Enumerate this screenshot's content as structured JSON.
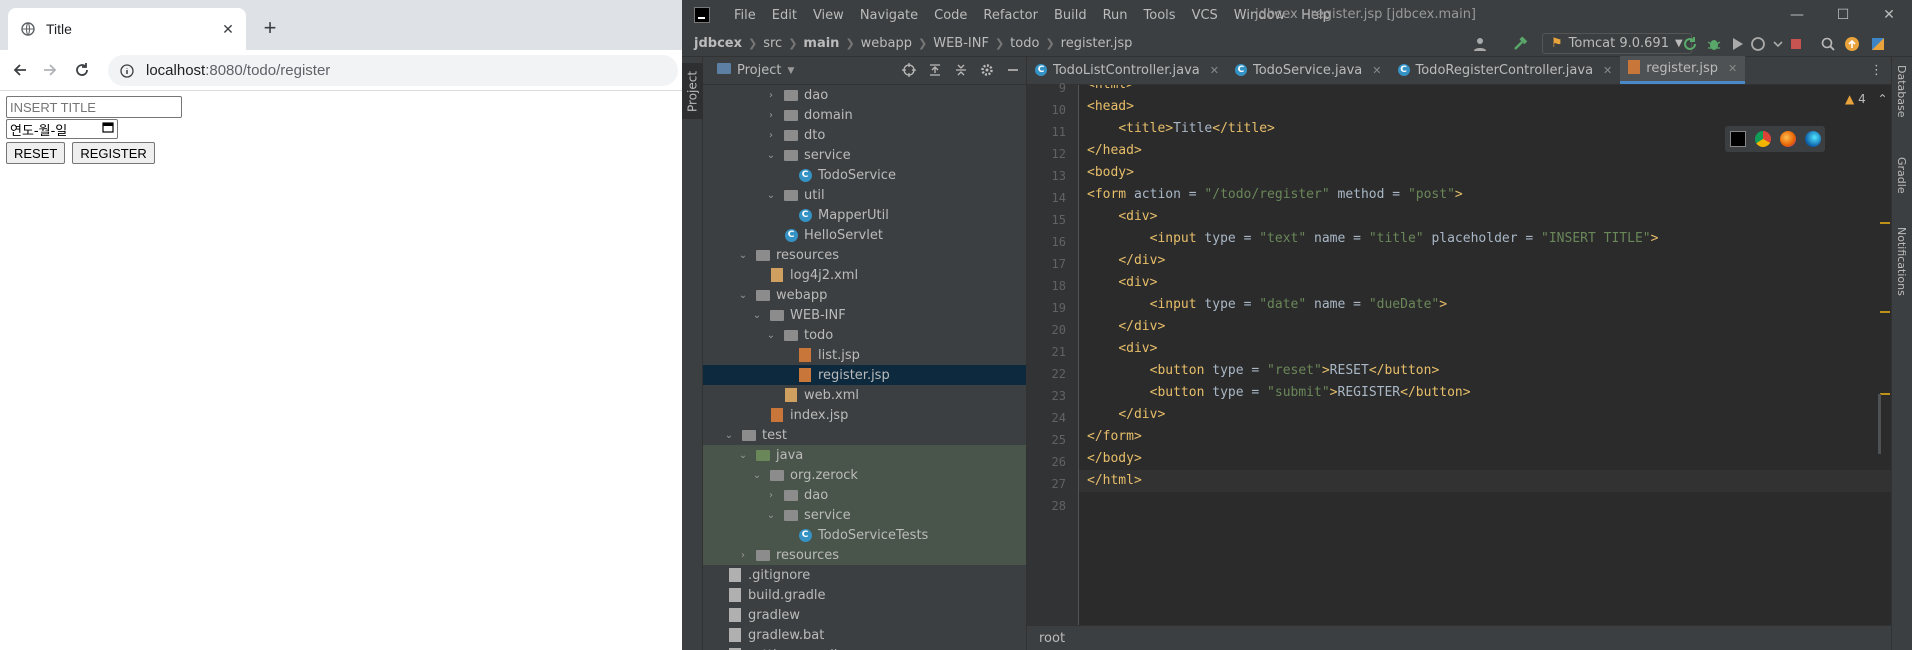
{
  "browser": {
    "tab_title": "Title",
    "url_host": "localhost",
    "url_rest": ":8080/todo/register",
    "form": {
      "title_placeholder": "INSERT TITLE",
      "date_value": "연도-월-일",
      "reset_label": "RESET",
      "register_label": "REGISTER"
    }
  },
  "ide": {
    "menu": [
      "File",
      "Edit",
      "View",
      "Navigate",
      "Code",
      "Refactor",
      "Build",
      "Run",
      "Tools",
      "VCS",
      "Window",
      "Help"
    ],
    "window_title": "jdbcex - register.jsp [jdbcex.main]",
    "breadcrumbs": [
      "jdbcex",
      "src",
      "main",
      "webapp",
      "WEB-INF",
      "todo",
      "register.jsp"
    ],
    "run_config": "Tomcat 9.0.691",
    "project_panel_title": "Project",
    "left_tab": "Project",
    "right_tabs": [
      "Database",
      "Gradle",
      "Notifications"
    ],
    "tree": [
      {
        "label": "dao",
        "type": "folder",
        "depth": 5,
        "expanded": false
      },
      {
        "label": "domain",
        "type": "folder",
        "depth": 5,
        "expanded": false
      },
      {
        "label": "dto",
        "type": "folder",
        "depth": 5,
        "expanded": false
      },
      {
        "label": "service",
        "type": "folder",
        "depth": 5,
        "expanded": true
      },
      {
        "label": "TodoService",
        "type": "class",
        "depth": 6
      },
      {
        "label": "util",
        "type": "folder",
        "depth": 5,
        "expanded": true
      },
      {
        "label": "MapperUtil",
        "type": "class",
        "depth": 6
      },
      {
        "label": "HelloServlet",
        "type": "class",
        "depth": 5
      },
      {
        "label": "resources",
        "type": "folder",
        "depth": 3,
        "expanded": true
      },
      {
        "label": "log4j2.xml",
        "type": "xml",
        "depth": 4
      },
      {
        "label": "webapp",
        "type": "folder",
        "depth": 3,
        "expanded": true
      },
      {
        "label": "WEB-INF",
        "type": "folder",
        "depth": 4,
        "expanded": true
      },
      {
        "label": "todo",
        "type": "folder",
        "depth": 5,
        "expanded": true
      },
      {
        "label": "list.jsp",
        "type": "jsp",
        "depth": 6
      },
      {
        "label": "register.jsp",
        "type": "jsp",
        "depth": 6,
        "selected": true
      },
      {
        "label": "web.xml",
        "type": "xml",
        "depth": 5
      },
      {
        "label": "index.jsp",
        "type": "jsp",
        "depth": 4
      },
      {
        "label": "test",
        "type": "folder",
        "depth": 2,
        "expanded": true
      },
      {
        "label": "java",
        "type": "testfolder",
        "depth": 3,
        "expanded": true,
        "test": true
      },
      {
        "label": "org.zerock",
        "type": "folder",
        "depth": 4,
        "expanded": true,
        "test": true
      },
      {
        "label": "dao",
        "type": "folder",
        "depth": 5,
        "expanded": false,
        "test": true
      },
      {
        "label": "service",
        "type": "folder",
        "depth": 5,
        "expanded": true,
        "test": true
      },
      {
        "label": "TodoServiceTests",
        "type": "class",
        "depth": 6,
        "test": true
      },
      {
        "label": "resources",
        "type": "folder",
        "depth": 3,
        "test": true
      },
      {
        "label": ".gitignore",
        "type": "file",
        "depth": 1
      },
      {
        "label": "build.gradle",
        "type": "file",
        "depth": 1
      },
      {
        "label": "gradlew",
        "type": "file",
        "depth": 1
      },
      {
        "label": "gradlew.bat",
        "type": "file",
        "depth": 1
      },
      {
        "label": "settings.gradle",
        "type": "file",
        "depth": 1
      }
    ],
    "editor_tabs": [
      {
        "label": "TodoListController.java",
        "active": false
      },
      {
        "label": "TodoService.java",
        "active": false
      },
      {
        "label": "TodoRegisterController.java",
        "active": false
      },
      {
        "label": "register.jsp",
        "active": true
      }
    ],
    "warning_count": "4",
    "line_numbers": [
      "9",
      "10",
      "11",
      "12",
      "13",
      "14",
      "15",
      "16",
      "17",
      "18",
      "19",
      "20",
      "21",
      "22",
      "23",
      "24",
      "25",
      "26",
      "27",
      "28"
    ],
    "code_lines": [
      "<html>",
      "<head>",
      "    <title>Title</title>",
      "</head>",
      "<body>",
      "<form action = \"/todo/register\" method = \"post\">",
      "    <div>",
      "        <input type = \"text\" name = \"title\" placeholder = \"INSERT TITLE\">",
      "    </div>",
      "    <div>",
      "        <input type = \"date\" name = \"dueDate\">",
      "    </div>",
      "    <div>",
      "        <button type = \"reset\">RESET</button>",
      "        <button type = \"submit\">REGISTER</button>",
      "    </div>",
      "</form>",
      "</body>",
      "</html>",
      ""
    ],
    "status_text": "root"
  }
}
